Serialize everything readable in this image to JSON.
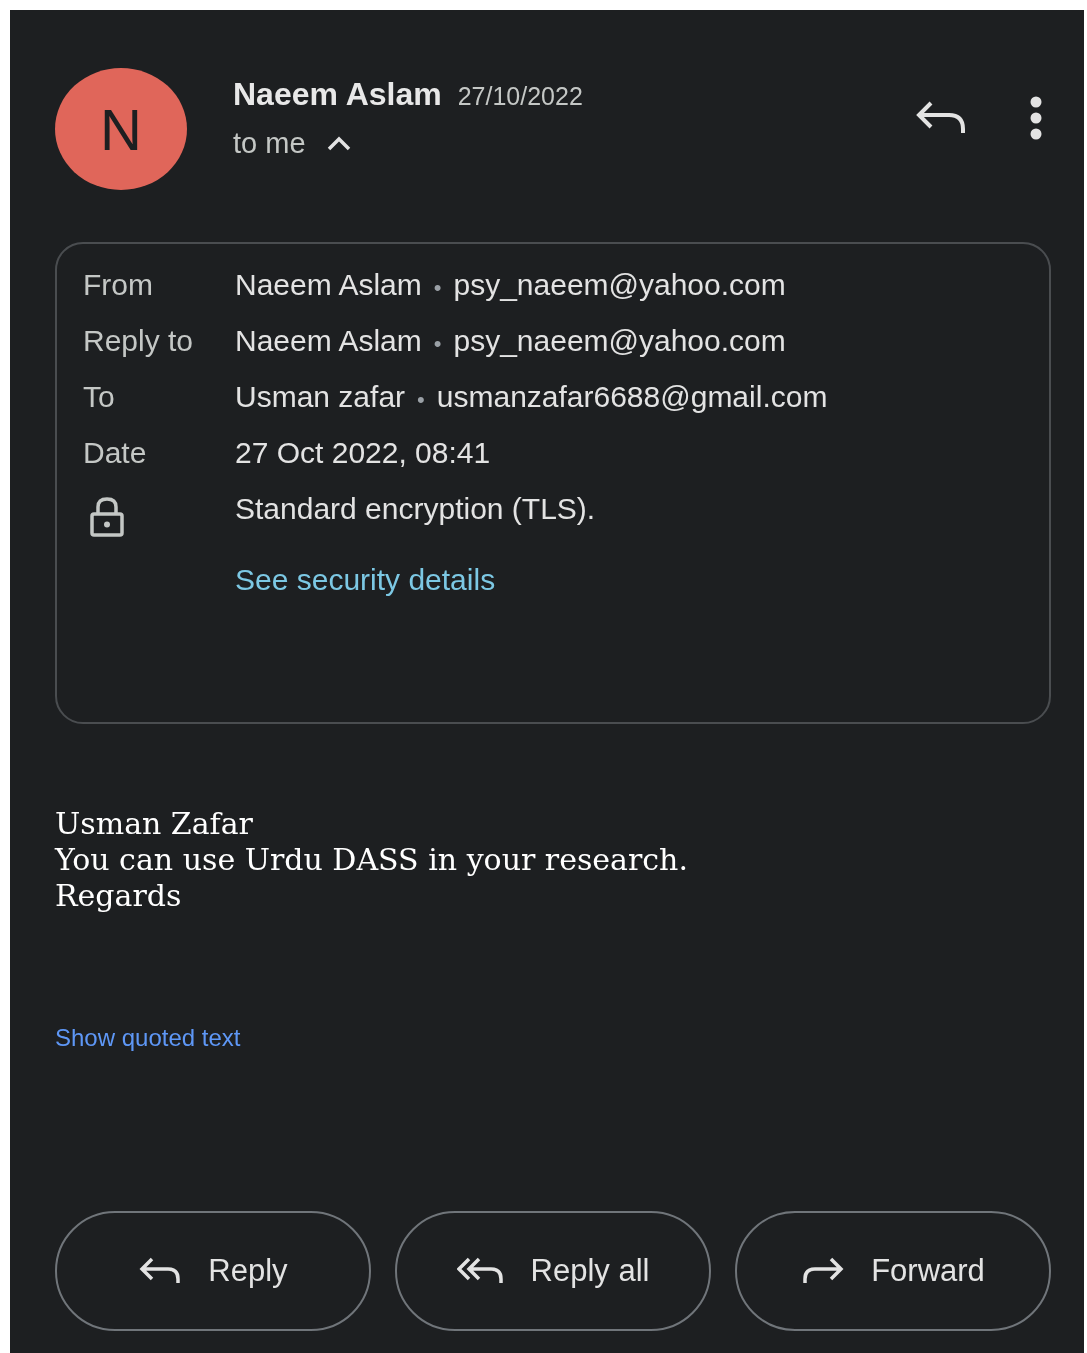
{
  "sender": {
    "initial": "N",
    "name": "Naeem Aslam",
    "date": "27/10/2022",
    "recipient": "to me",
    "expanded": true
  },
  "details": [
    {
      "kind": "contact",
      "label": "From",
      "name": "Naeem Aslam",
      "separator": "•",
      "email": "psy_naeem@yahoo.com"
    },
    {
      "kind": "contact",
      "label": "Reply to",
      "name": "Naeem Aslam",
      "separator": "•",
      "email": "psy_naeem@yahoo.com"
    },
    {
      "kind": "contact",
      "label": "To",
      "name": "Usman zafar",
      "separator": "•",
      "email": "usmanzafar6688@gmail.com"
    },
    {
      "kind": "date",
      "label": "Date",
      "value": "27 Oct 2022, 08:41"
    },
    {
      "kind": "security",
      "value": "Standard encryption (TLS).",
      "link": "See security details"
    }
  ],
  "body": [
    "Usman Zafar",
    "You can use Urdu DASS in your research.",
    "Regards"
  ],
  "quoted_link": "Show quoted text",
  "actions": [
    {
      "kind": "reply",
      "label": "Reply"
    },
    {
      "kind": "reply_all",
      "label": "Reply all"
    },
    {
      "kind": "forward",
      "label": "Forward"
    }
  ]
}
